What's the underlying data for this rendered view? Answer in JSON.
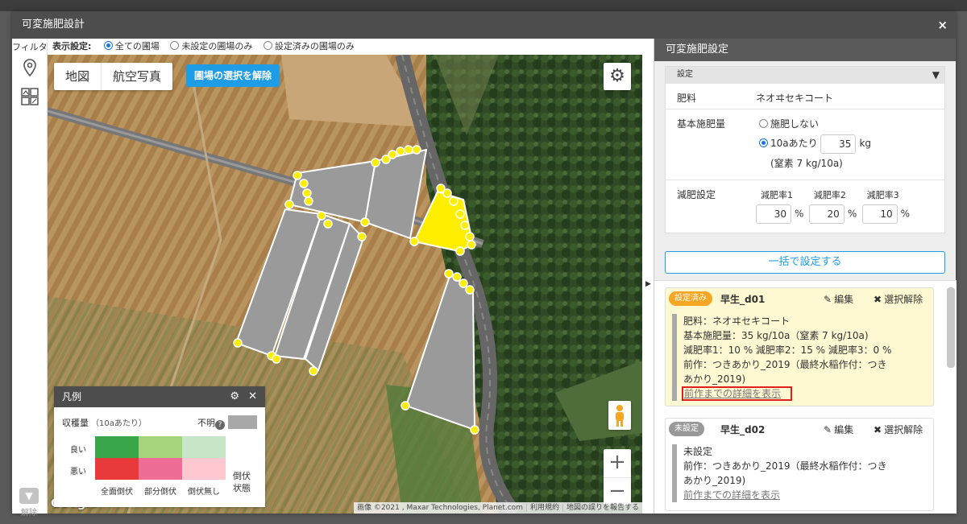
{
  "dialog": {
    "title": "可変施肥設計",
    "close_icon": "×"
  },
  "leftbar": {
    "filter_label": "フィルタ",
    "clear_label": "解除"
  },
  "display": {
    "label": "表示設定:",
    "options": [
      "全ての圃場",
      "未設定の圃場のみ",
      "設定済みの圃場のみ"
    ],
    "selected": "全ての圃場"
  },
  "map": {
    "tabs": [
      "地図",
      "航空写真"
    ],
    "deselect_button": "圃場の選択を解除",
    "google": "Google",
    "attribution": [
      "画像 ©2021 , Maxar Technologies, Planet.com",
      "利用規約",
      "地図の誤りを報告する"
    ]
  },
  "legend": {
    "title": "凡例",
    "yield_label": "収穫量",
    "yield_unit": "（10aあたり）",
    "unknown_label": "不明",
    "good_label": "良い",
    "bad_label": "悪い",
    "col_labels": [
      "全面倒伏",
      "部分倒伏",
      "倒伏無し"
    ],
    "lodging_label": "倒伏状態",
    "colors": {
      "good": [
        "#3aa64a",
        "#a6d47c",
        "#c8e6c8"
      ],
      "bad": [
        "#e83a3a",
        "#ee6d95",
        "#ffc8d0"
      ],
      "unknown": "#a8a8a8"
    }
  },
  "panel": {
    "title": "可変施肥設定",
    "settings_header": "設定",
    "fertilizer_label": "肥料",
    "fertilizer_value": "ネオヰセキコート",
    "base_label": "基本施肥量",
    "base_opt_none": "施肥しない",
    "base_opt_per": "10aあたり",
    "base_amount": "35",
    "base_unit": "kg",
    "nitrogen_note": "(窒素 7 kg/10a)",
    "reduction_label": "減肥設定",
    "rates": [
      {
        "label": "減肥率1",
        "value": "30"
      },
      {
        "label": "減肥率2",
        "value": "20"
      },
      {
        "label": "減肥率3",
        "value": "10"
      }
    ],
    "percent": "%",
    "bulk_button": "一括で設定する"
  },
  "cards": [
    {
      "status": "設定済み",
      "name": "早生_d01",
      "edit": "編集",
      "deselect": "選択解除",
      "lines": [
        "肥料：ネオヰセキコート",
        "基本施肥量：35 kg/10a（窒素 7 kg/10a)",
        "減肥率1：10 %  減肥率2：15 %  減肥率3：0 %",
        "前作：つきあかり_2019（最終水稲作付：つき",
        "あかり_2019)"
      ],
      "detail_link": "前作までの詳細を表示"
    },
    {
      "status": "未設定",
      "name": "早生_d02",
      "edit": "編集",
      "deselect": "選択解除",
      "lines": [
        "未設定",
        "前作：つきあかり_2019（最終水稲作付：つき",
        "あかり_2019)"
      ],
      "detail_link": "前作までの詳細を表示"
    }
  ]
}
